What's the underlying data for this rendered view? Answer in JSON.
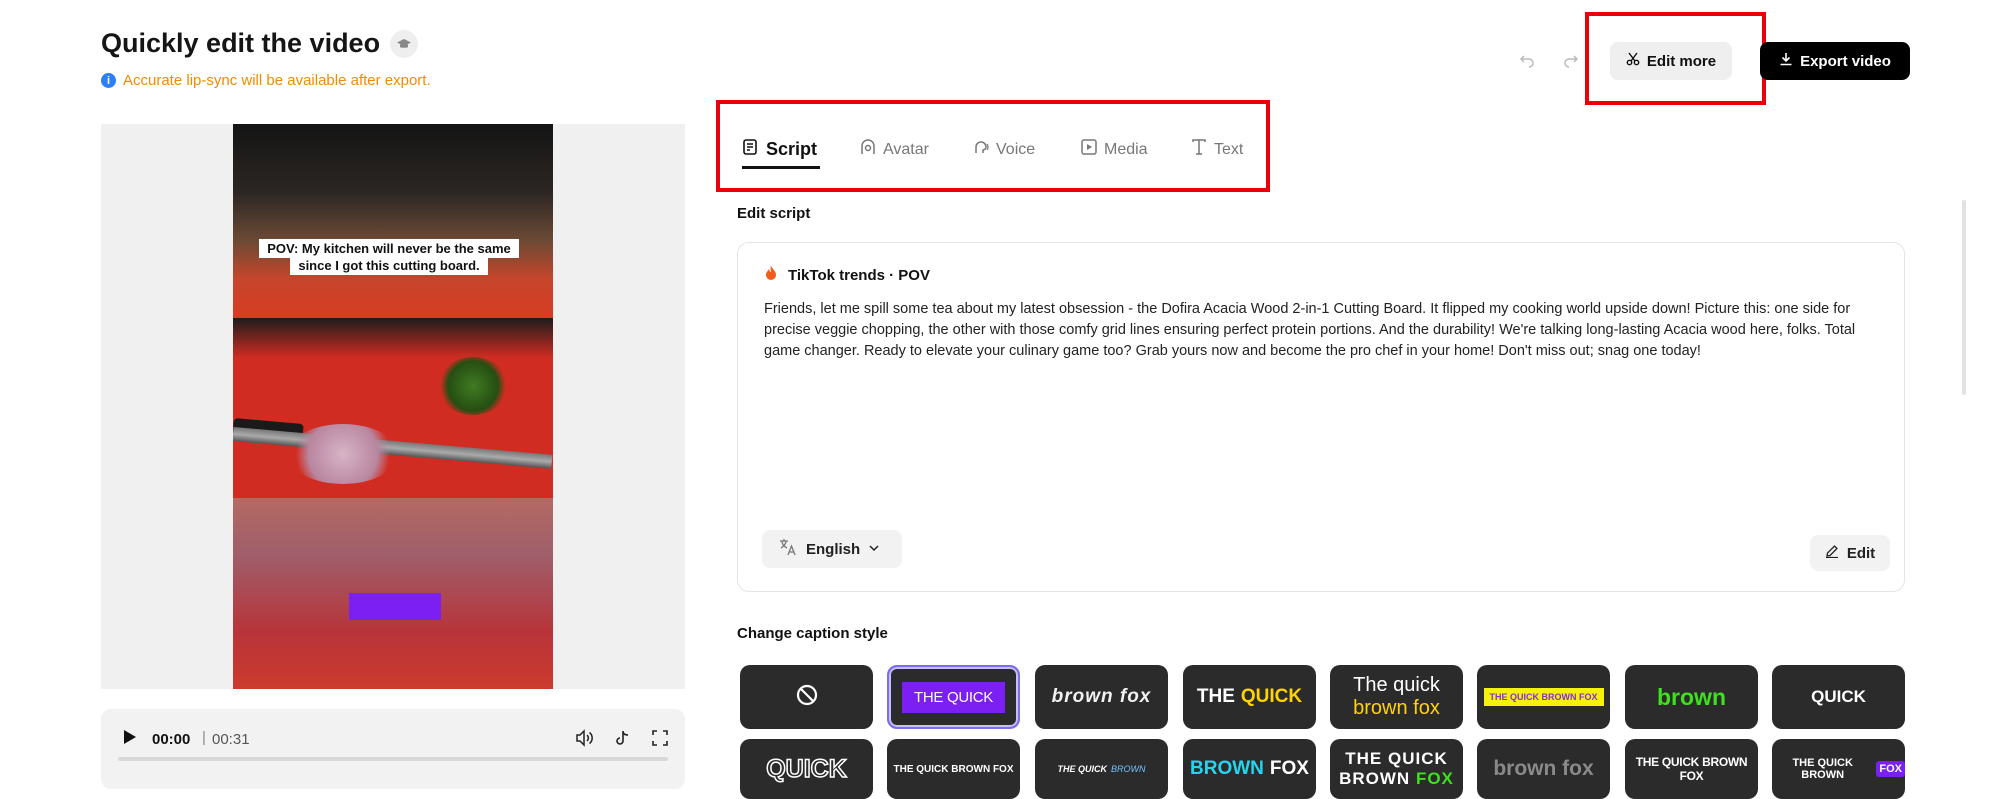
{
  "header": {
    "title": "Quickly edit the video",
    "notice": "Accurate lip-sync will be available after export.",
    "edit_more_label": "Edit more",
    "export_label": "Export video"
  },
  "video": {
    "overlay_caption_line1": "POV: My kitchen will never be the same",
    "overlay_caption_line2": "since I got this cutting board."
  },
  "player": {
    "current_time": "00:00",
    "separator": "|",
    "total_time": "00:31",
    "progress": 0
  },
  "tabs": [
    {
      "label": "Script",
      "icon": "script-icon",
      "active": true
    },
    {
      "label": "Avatar",
      "icon": "avatar-icon",
      "active": false
    },
    {
      "label": "Voice",
      "icon": "voice-icon",
      "active": false
    },
    {
      "label": "Media",
      "icon": "media-icon",
      "active": false
    },
    {
      "label": "Text",
      "icon": "text-icon",
      "active": false
    }
  ],
  "script": {
    "section_label": "Edit script",
    "template_name": "TikTok trends · POV",
    "body": "Friends, let me spill some tea about my latest obsession - the Dofira Acacia Wood 2-in-1 Cutting Board. It flipped my cooking world upside down! Picture this: one side for precise veggie chopping, the other with those comfy grid lines ensuring perfect protein portions. And the durability! We're talking long-lasting Acacia wood here, folks. Total game changer. Ready to elevate your culinary game too? Grab yours now and become the pro chef in your home! Don't miss out; snag one today!",
    "language": "English",
    "edit_label": "Edit"
  },
  "caption_style": {
    "section_label": "Change caption style",
    "row1": [
      {
        "id": "none",
        "text": ""
      },
      {
        "id": "purple-box",
        "text": "THE QUICK"
      },
      {
        "id": "brown-fox-italic",
        "text": "brown fox"
      },
      {
        "id": "the-quick-yellow",
        "text_a": "THE",
        "text_b": "QUICK"
      },
      {
        "id": "quick-brown-two-line",
        "text_a": "The quick",
        "text_b": "brown fox"
      },
      {
        "id": "yellow-highlight",
        "text": "THE QUICK BROWN FOX"
      },
      {
        "id": "green-brown",
        "text": "brown"
      },
      {
        "id": "quick-white",
        "text": "QUICK"
      }
    ],
    "row2": [
      {
        "id": "quick-outline",
        "text": "QUICK"
      },
      {
        "id": "small-caps-white",
        "text": "THE QUICK BROWN FOX"
      },
      {
        "id": "italic-blue",
        "text_a": "THE QUICK",
        "text_b": "BROWN"
      },
      {
        "id": "brown-fox-cyan",
        "text_a": "BROWN",
        "text_b": "FOX"
      },
      {
        "id": "two-line-green",
        "text_a": "THE QUICK",
        "text_b": "BROWN",
        "text_c": "FOX"
      },
      {
        "id": "brown-fox-grey",
        "text": "brown fox"
      },
      {
        "id": "condensed-white",
        "text": "THE QUICK BROWN FOX"
      },
      {
        "id": "purple-fox",
        "text_a": "THE QUICK BROWN",
        "text_b": "FOX"
      }
    ]
  },
  "colors": {
    "accent_purple": "#7b1ff2",
    "notice_orange": "#f08c00",
    "highlight_red": "#e8000b"
  }
}
